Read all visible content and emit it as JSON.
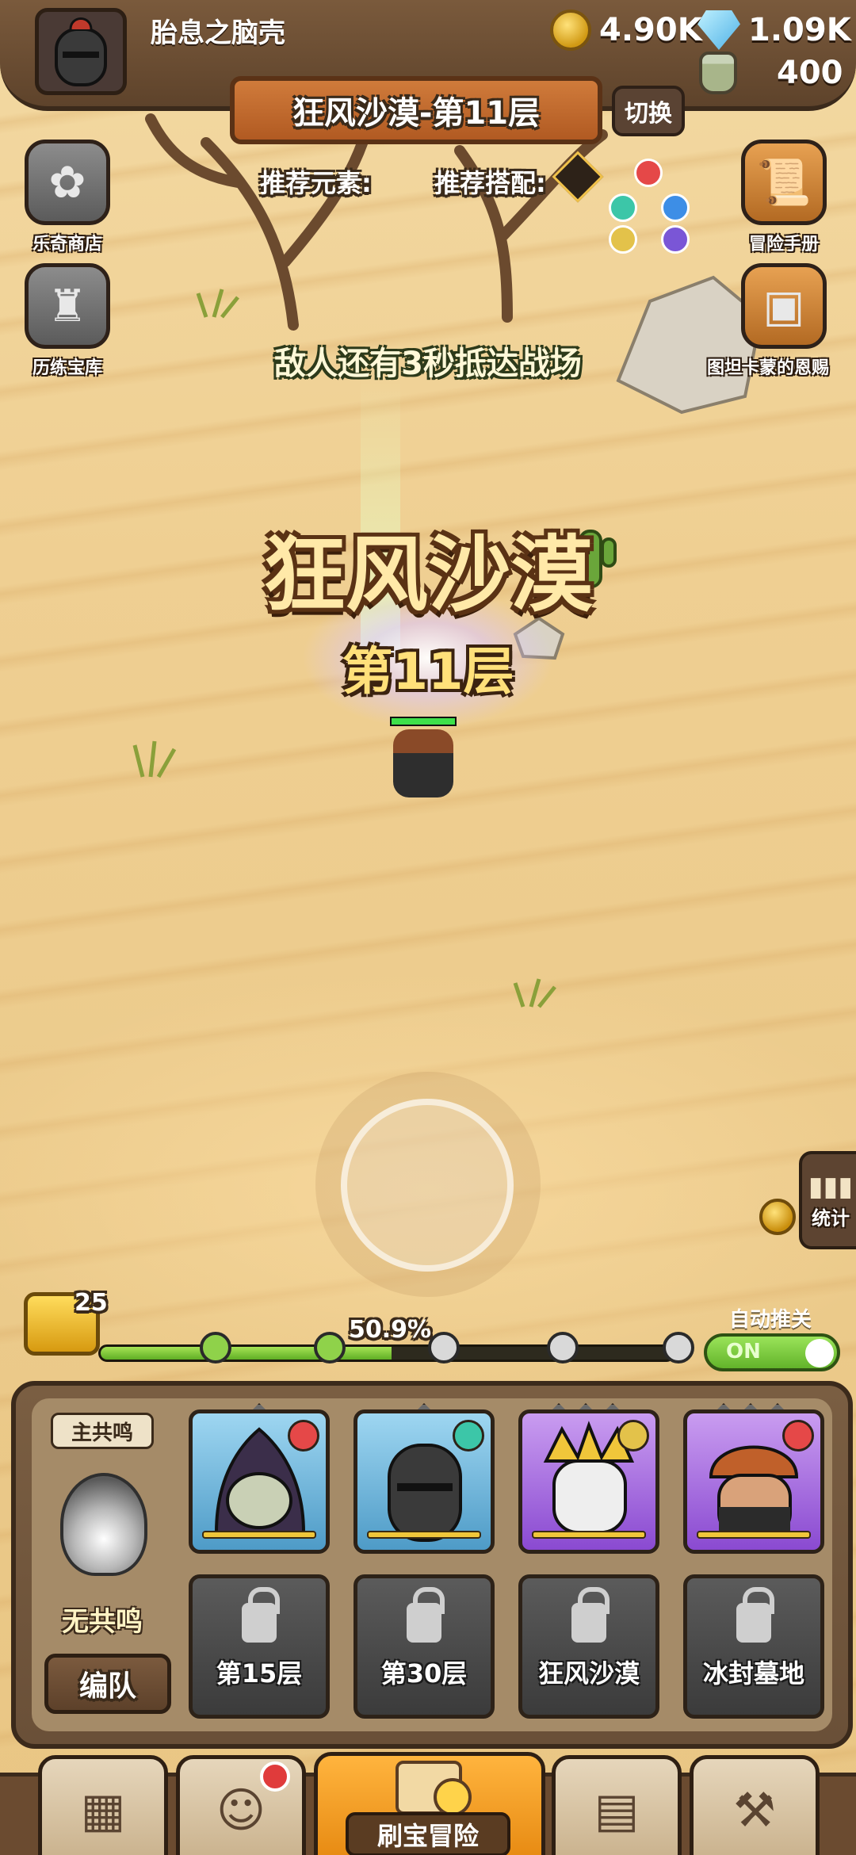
{
  "player": {
    "name": "胎息之脑壳"
  },
  "resources": {
    "gold": "4.90K",
    "gems": "1.09K",
    "potion": "400"
  },
  "stage": {
    "banner": "狂风沙漠-第11层",
    "switch_label": "切换"
  },
  "recommend": {
    "element_label": "推荐元素:",
    "combo_label": "推荐搭配:"
  },
  "side_left": [
    {
      "label": "乐奇商店",
      "icon": "flower-icon"
    },
    {
      "label": "历练宝库",
      "icon": "vault-icon"
    }
  ],
  "side_right": [
    {
      "label": "冒险手册",
      "icon": "scroll-icon"
    },
    {
      "label": "图坦卡蒙的恩赐",
      "icon": "treasure-chest-icon"
    }
  ],
  "countdown": "敌人还有3秒抵达战场",
  "zone": {
    "name": "狂风沙漠",
    "floor": "第11层"
  },
  "stats_label": "统计",
  "progress": {
    "chest_count": "25",
    "percent_text": "50.9%",
    "fraction": 0.509
  },
  "auto": {
    "label": "自动推关",
    "toggle_text": "ON",
    "on": true
  },
  "resonance": {
    "tag": "主共鸣",
    "status": "无共鸣",
    "team_button": "编队"
  },
  "heroes": [
    {
      "name": "hero-skull-witch",
      "element": "fire",
      "rarity": "blue"
    },
    {
      "name": "hero-dark-knight",
      "element": "wind",
      "rarity": "blue"
    },
    {
      "name": "hero-crowned-king",
      "element": "light",
      "rarity": "purple"
    },
    {
      "name": "hero-turban-warrior",
      "element": "fire",
      "rarity": "purple"
    }
  ],
  "locked_slots": [
    "第15层",
    "第30层",
    "狂风沙漠",
    "冰封墓地"
  ],
  "nav": {
    "center_label": "刷宝冒险"
  },
  "colors": {
    "accent": "#e78a12",
    "panel": "#7a5e42",
    "progress": "#8fd24a"
  }
}
